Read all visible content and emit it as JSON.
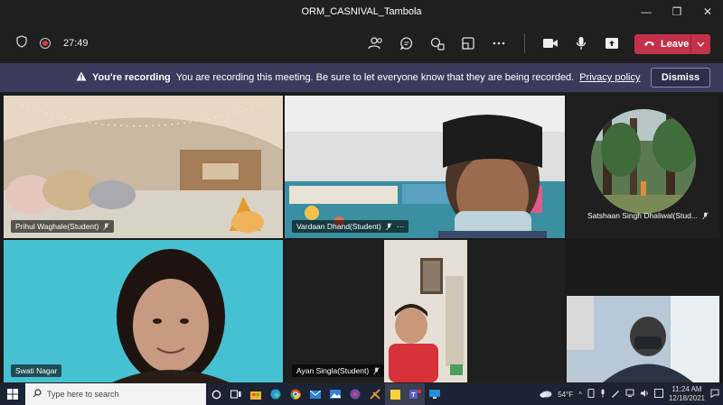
{
  "window": {
    "title": "ORM_CASNIVAL_Tambola"
  },
  "toolbar": {
    "timer": "27:49",
    "leave_label": "Leave"
  },
  "banner": {
    "title": "You're recording",
    "message": "You are recording this meeting. Be sure to let everyone know that they are being recorded.",
    "link": "Privacy policy",
    "dismiss": "Dismiss"
  },
  "participants": [
    {
      "name": "Prihul Waghale(Student)"
    },
    {
      "name": "Vardaan Dhand(Student)"
    },
    {
      "name": "Satshaan Singh Dhaliwal(Stud..."
    },
    {
      "name": "Swati Nagar"
    },
    {
      "name": "Ayan Singla(Student)"
    }
  ],
  "taskbar": {
    "search_placeholder": "Type here to search",
    "weather": "54°F",
    "time": "11:24 AM",
    "date": "12/18/2021"
  },
  "colors": {
    "leave": "#c4314b",
    "banner": "#3b3a5c",
    "recording": "#e03a3a"
  }
}
